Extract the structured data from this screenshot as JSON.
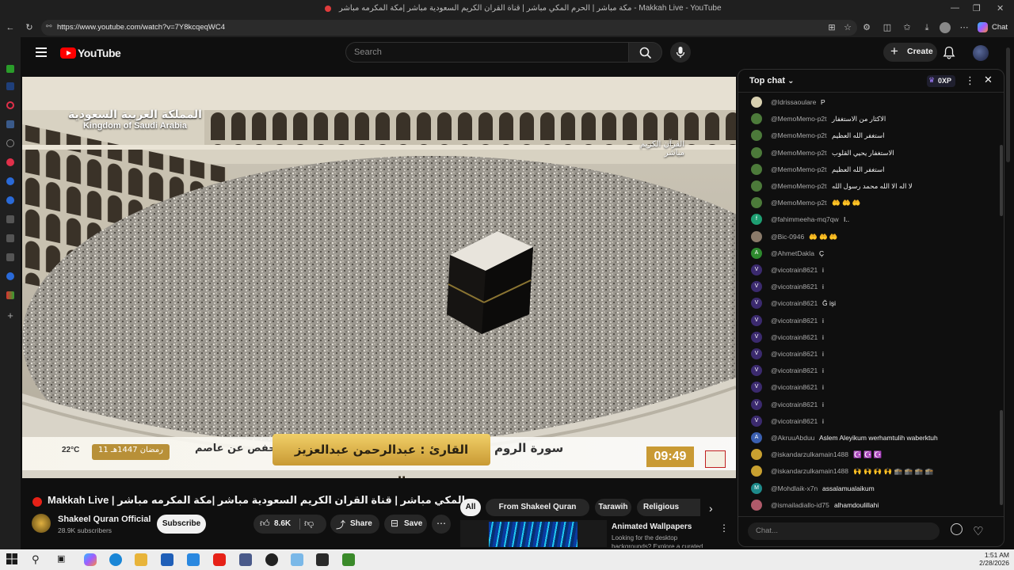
{
  "browser": {
    "window_title": "مكة مباشر | الحرم المكي مباشر | قناة القران الكريم السعودية مباشر |مكة المكرمه مباشر - Makkah Live - YouTube",
    "url": "https://www.youtube.com/watch?v=7Y8kcqeqWC4",
    "copilot_label": "Chat"
  },
  "youtube": {
    "logo_text": "YouTube",
    "search_placeholder": "Search",
    "create_label": "Create"
  },
  "video": {
    "overlay": {
      "country_ar": "المملكة العربية السعودية",
      "country_en": "Kingdom of Saudi Arabia",
      "channel_ar_1": "القرآن الكريم",
      "channel_ar_2": "مباشر",
      "reader": "القارئ : عبدالرحمن عبدالعزيز السديس",
      "surah": "سورة الروم",
      "narration": "رواية حفص عن عاصم",
      "date_hijri": "11 رمضان 1447هـ",
      "temperature": "22°C",
      "clock": "09:49"
    }
  },
  "below_video": {
    "title": "Makkah Live | مكة مباشر | الحرم المكي مباشر | قناة القران الكريم السعودية مباشر |مكة المكرمه مباشر",
    "channel_name": "Shakeel Quran Official",
    "subscribers": "28.9K subscribers",
    "subscribe_label": "Subscribe",
    "likes": "8.6K",
    "share_label": "Share",
    "save_label": "Save"
  },
  "chips": [
    "All",
    "From Shakeel Quran Official",
    "Tarawih",
    "Religious recitat"
  ],
  "recommendation": {
    "title": "Animated Wallpapers",
    "desc": "Looking for the desktop backgrounds? Explore a curated"
  },
  "chat": {
    "header_label": "Top chat",
    "xp": "0XP",
    "input_placeholder": "Chat...",
    "messages": [
      {
        "author": "@Idrissaoulare",
        "text": "P",
        "avatar": "",
        "color": "#d8d0b0"
      },
      {
        "author": "@MemoMemo-p2t",
        "text": "الاكثار من الاستغفار",
        "avatar": "",
        "color": "#4c7a3a"
      },
      {
        "author": "@MemoMemo-p2t",
        "text": "استغفر الله العظيم",
        "avatar": "",
        "color": "#4c7a3a"
      },
      {
        "author": "@MemoMemo-p2t",
        "text": "الاستغفار يحيي القلوب",
        "avatar": "",
        "color": "#4c7a3a"
      },
      {
        "author": "@MemoMemo-p2t",
        "text": "استغفر الله العظيم",
        "avatar": "",
        "color": "#4c7a3a"
      },
      {
        "author": "@MemoMemo-p2t",
        "text": "لا اله الا الله محمد رسول الله",
        "avatar": "",
        "color": "#4c7a3a"
      },
      {
        "author": "@MemoMemo-p2t",
        "text": "🤲 🤲 🤲",
        "avatar": "",
        "color": "#4c7a3a"
      },
      {
        "author": "@fahimmeeha-mq7qw",
        "text": "I..",
        "avatar": "f",
        "color": "#1e9e72"
      },
      {
        "author": "@Bic-0946",
        "text": "🤲 🤲 🤲",
        "avatar": "",
        "color": "#8a7a6a"
      },
      {
        "author": "@AhmetDakla",
        "text": "Ç",
        "avatar": "A",
        "color": "#2e8a2e"
      },
      {
        "author": "@vicotrain8621",
        "text": "i",
        "avatar": "V",
        "color": "#3b2a6e"
      },
      {
        "author": "@vicotrain8621",
        "text": "i",
        "avatar": "V",
        "color": "#3b2a6e"
      },
      {
        "author": "@vicotrain8621",
        "text": "Ğ işi",
        "avatar": "V",
        "color": "#3b2a6e"
      },
      {
        "author": "@vicotrain8621",
        "text": "i",
        "avatar": "V",
        "color": "#3b2a6e"
      },
      {
        "author": "@vicotrain8621",
        "text": "i",
        "avatar": "V",
        "color": "#3b2a6e"
      },
      {
        "author": "@vicotrain8621",
        "text": "i",
        "avatar": "V",
        "color": "#3b2a6e"
      },
      {
        "author": "@vicotrain8621",
        "text": "i",
        "avatar": "V",
        "color": "#3b2a6e"
      },
      {
        "author": "@vicotrain8621",
        "text": "i",
        "avatar": "V",
        "color": "#3b2a6e"
      },
      {
        "author": "@vicotrain8621",
        "text": "i",
        "avatar": "V",
        "color": "#3b2a6e"
      },
      {
        "author": "@vicotrain8621",
        "text": "i",
        "avatar": "V",
        "color": "#3b2a6e"
      },
      {
        "author": "@AkruuAbduu",
        "text": "Aslem Aleyikum werhamtulih waberktuh",
        "avatar": "A",
        "color": "#3a5fb0"
      },
      {
        "author": "@iskandarzulkamain1488",
        "text": "☪️ ☪️ ☪️",
        "avatar": "",
        "color": "#c8a030"
      },
      {
        "author": "@iskandarzulkamain1488",
        "text": "🙌 🙌 🙌 🙌 🕋 🕋 🕋 🕋",
        "avatar": "",
        "color": "#c8a030"
      },
      {
        "author": "@Mohdlaik-x7n",
        "text": "assalamualaikum",
        "avatar": "M",
        "color": "#1e8a8a"
      },
      {
        "author": "@ismailadiallo-id75",
        "text": "alhamdoulillahi",
        "avatar": "",
        "color": "#b05a6a"
      }
    ]
  },
  "taskbar": {
    "time": "1:51 AM",
    "date": "2/28/2026"
  },
  "colors": {
    "youtube_red": "#ff0000",
    "background": "#0f0f0f",
    "overlay_gold": "#e0b84a"
  }
}
